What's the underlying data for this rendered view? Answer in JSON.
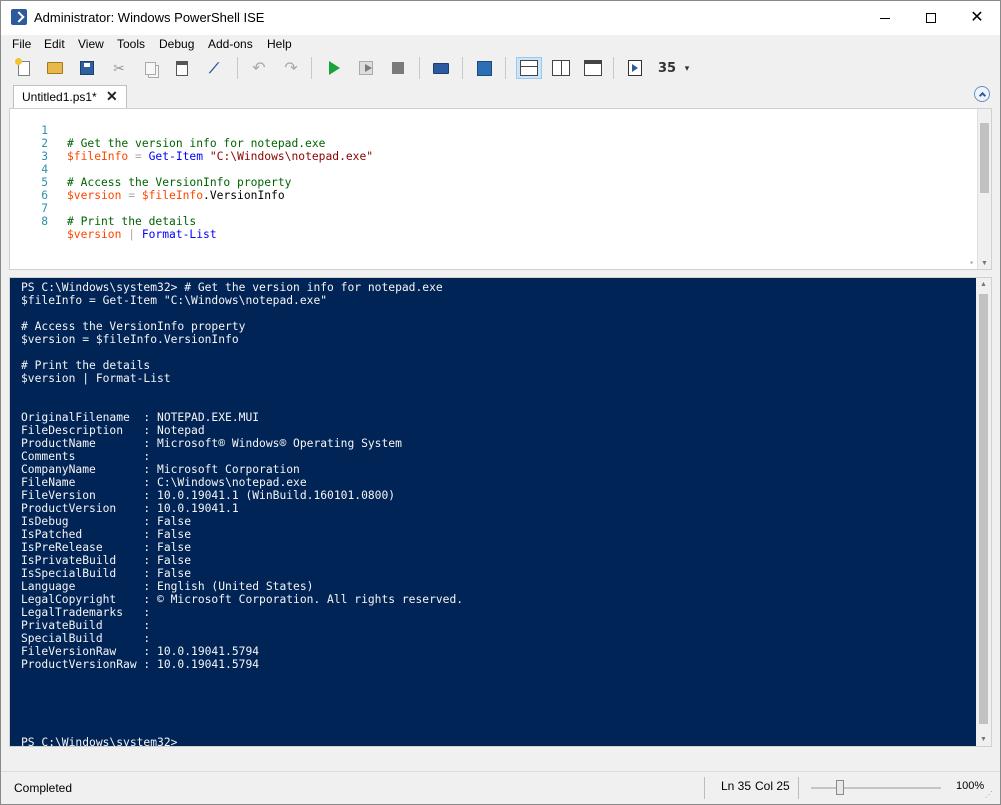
{
  "window": {
    "title": "Administrator: Windows PowerShell ISE",
    "close_glyph": "✕"
  },
  "menu": [
    "File",
    "Edit",
    "View",
    "Tools",
    "Debug",
    "Add-ons",
    "Help"
  ],
  "toolbar": {
    "cut_glyph": "✂",
    "undo_glyph": "↶",
    "redo_glyph": "↷",
    "clear_glyph": "⟋",
    "addons_glyph": "35",
    "overflow_glyph": "▾"
  },
  "tabs": [
    {
      "label": "Untitled1.ps1*",
      "close": "✕"
    }
  ],
  "script": {
    "line_numbers": [
      "1",
      "2",
      "3",
      "4",
      "5",
      "6",
      "7",
      "8"
    ],
    "lines": [
      {
        "comment": "# Get the version info for notepad.exe"
      },
      {
        "var": "$fileInfo",
        "op": " = ",
        "cmd": "Get-Item",
        "space": " ",
        "str": "\"C:\\Windows\\notepad.exe\""
      },
      {},
      {
        "comment": "# Access the VersionInfo property"
      },
      {
        "var": "$version",
        "op": " = ",
        "var2": "$fileInfo",
        "member": ".VersionInfo"
      },
      {},
      {
        "comment": "# Print the details"
      },
      {
        "var": "$version",
        "op": " | ",
        "cmd": "Format-List"
      }
    ]
  },
  "console": {
    "lines": [
      "PS C:\\Windows\\system32> # Get the version info for notepad.exe",
      "$fileInfo = Get-Item \"C:\\Windows\\notepad.exe\"",
      "",
      "# Access the VersionInfo property",
      "$version = $fileInfo.VersionInfo",
      "",
      "# Print the details",
      "$version | Format-List",
      "",
      "",
      "OriginalFilename  : NOTEPAD.EXE.MUI",
      "FileDescription   : Notepad",
      "ProductName       : Microsoft® Windows® Operating System",
      "Comments          : ",
      "CompanyName       : Microsoft Corporation",
      "FileName          : C:\\Windows\\notepad.exe",
      "FileVersion       : 10.0.19041.1 (WinBuild.160101.0800)",
      "ProductVersion    : 10.0.19041.1",
      "IsDebug           : False",
      "IsPatched         : False",
      "IsPreRelease      : False",
      "IsPrivateBuild    : False",
      "IsSpecialBuild    : False",
      "Language          : English (United States)",
      "LegalCopyright    : © Microsoft Corporation. All rights reserved.",
      "LegalTrademarks   : ",
      "PrivateBuild      : ",
      "SpecialBuild      : ",
      "FileVersionRaw    : 10.0.19041.5794",
      "ProductVersionRaw : 10.0.19041.5794",
      "",
      "",
      "",
      "",
      "",
      "PS C:\\Windows\\system32>"
    ]
  },
  "status": {
    "text": "Completed",
    "line": "Ln 35",
    "col": "Col 25",
    "zoom": "100%",
    "zoom_level_percent": 100
  },
  "colors": {
    "console_bg": "#012456",
    "comment": "#006400",
    "variable": "#ff4500",
    "command": "#0000ff",
    "string": "#8b0000",
    "line_number": "#2b91af"
  }
}
